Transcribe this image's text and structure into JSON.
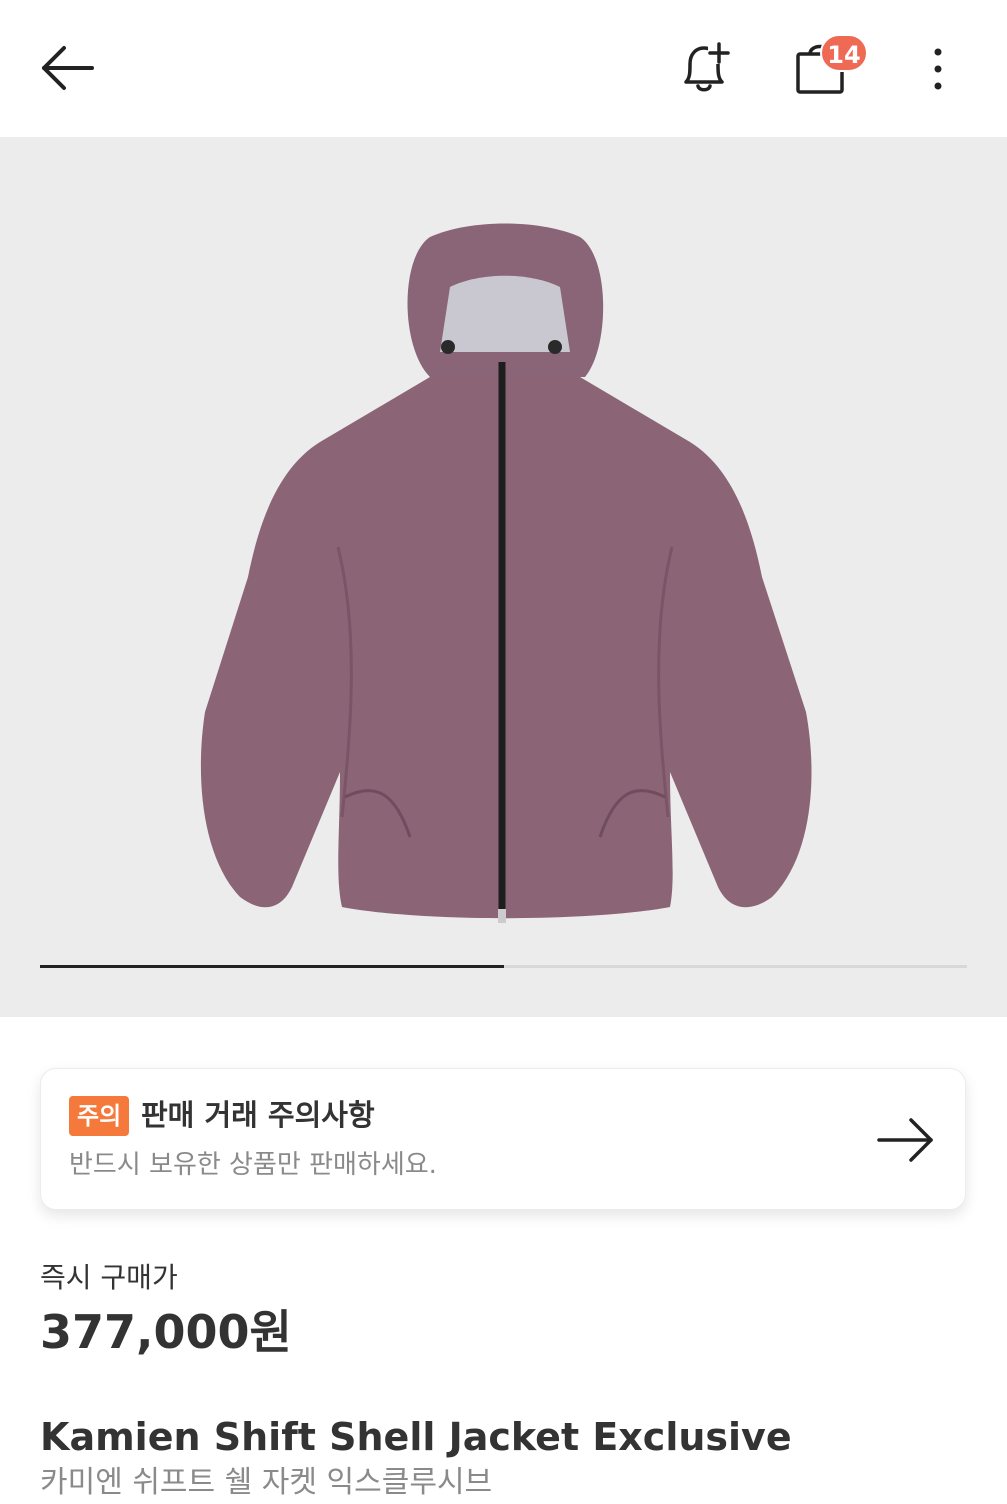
{
  "header": {
    "back_icon": "arrow-left-icon",
    "bell_icon": "bell-plus-icon",
    "bag_icon": "shopping-bag-icon",
    "more_icon": "more-vertical-icon",
    "cart_count": "14",
    "badge_color": "#ef6a55"
  },
  "gallery": {
    "image_subject": "mauve hooded zip jacket",
    "current_index": 1,
    "total_images": 2,
    "progress_fraction": 0.5
  },
  "notice": {
    "badge": "주의",
    "title": "판매 거래 주의사항",
    "description": "반드시 보유한 상품만 판매하세요.",
    "arrow_icon": "arrow-right-icon",
    "badge_color": "#f4793b"
  },
  "price": {
    "label": "즉시 구매가",
    "value": "377,000원"
  },
  "product": {
    "name": "Kamien Shift Shell Jacket Exclusive",
    "name_ko": "카미엔 쉬프트 쉘 자켓 익스클루시브"
  }
}
